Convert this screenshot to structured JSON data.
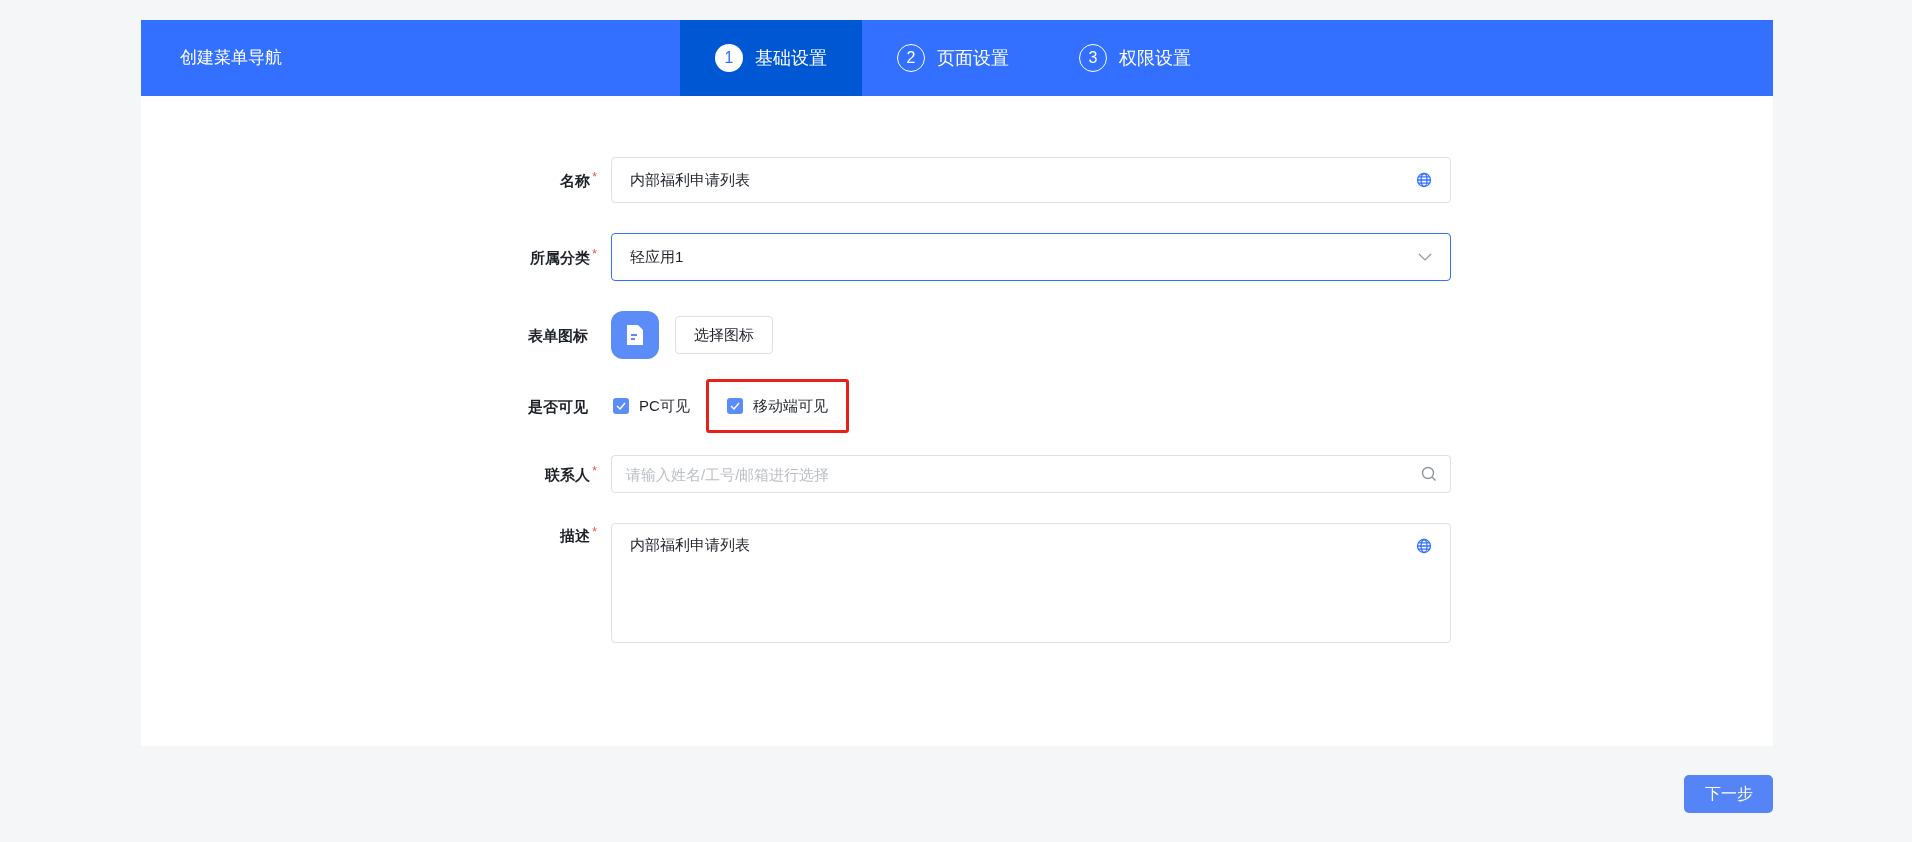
{
  "header": {
    "title": "创建菜单导航",
    "steps": [
      {
        "number": "1",
        "label": "基础设置",
        "selected": true
      },
      {
        "number": "2",
        "label": "页面设置",
        "selected": false
      },
      {
        "number": "3",
        "label": "权限设置",
        "selected": false
      }
    ]
  },
  "form": [
    {
      "kind": "text",
      "label": "名称",
      "required_mark": "*",
      "value": "内部福利申请列表"
    },
    {
      "kind": "select",
      "label": "所属分类",
      "required_mark": "*",
      "value": "轻应用1",
      "focused": true
    },
    {
      "kind": "icon",
      "label": "表单图标",
      "button": "选择图标"
    },
    {
      "kind": "checkboxes",
      "label": "是否可见",
      "options": [
        {
          "label": "PC可见",
          "checked": true,
          "highlighted": false
        },
        {
          "label": "移动端可见",
          "checked": true,
          "highlighted": true
        }
      ]
    },
    {
      "kind": "search",
      "label": "联系人",
      "required_mark": "*",
      "placeholder": "请输入姓名/工号/邮箱进行选择"
    },
    {
      "kind": "textarea",
      "label": "描述",
      "required_mark": "*",
      "value": "内部福利申请列表"
    }
  ],
  "next_button": "下一步"
}
